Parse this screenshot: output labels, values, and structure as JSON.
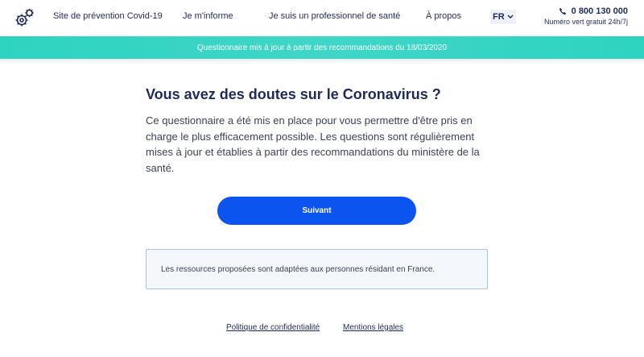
{
  "header": {
    "logo_icon": "coronavirus-gears-icon",
    "nav": [
      {
        "label": "Site de prévention Covid-19"
      },
      {
        "label": "Je m'informe"
      },
      {
        "label": "Je suis un professionnel de santé"
      },
      {
        "label": "À propos"
      }
    ],
    "language": "FR",
    "phone_number": "0 800 130 000",
    "phone_subtitle": "Numéro vert gratuit 24h/7j"
  },
  "banner": {
    "text": "Questionnaire mis à jour à partir des recommandations du 18/03/2020"
  },
  "main": {
    "title": "Vous avez des doutes sur le Coronavirus ?",
    "intro": "Ce questionnaire a été mis en place pour vous permettre d'être pris en charge le plus efficacement possible. Les questions sont régulièrement mises à jour et établies à partir des recommandations du ministère de la santé.",
    "next_button": "Suivant",
    "notice": "Les ressources proposées sont adaptées aux personnes résidant en France."
  },
  "footer": {
    "privacy": "Politique de confidentialité",
    "legal": "Mentions légales"
  },
  "colors": {
    "primary": "#0b54f0",
    "banner": "#2ed3c0",
    "text": "#1f2a5c"
  }
}
